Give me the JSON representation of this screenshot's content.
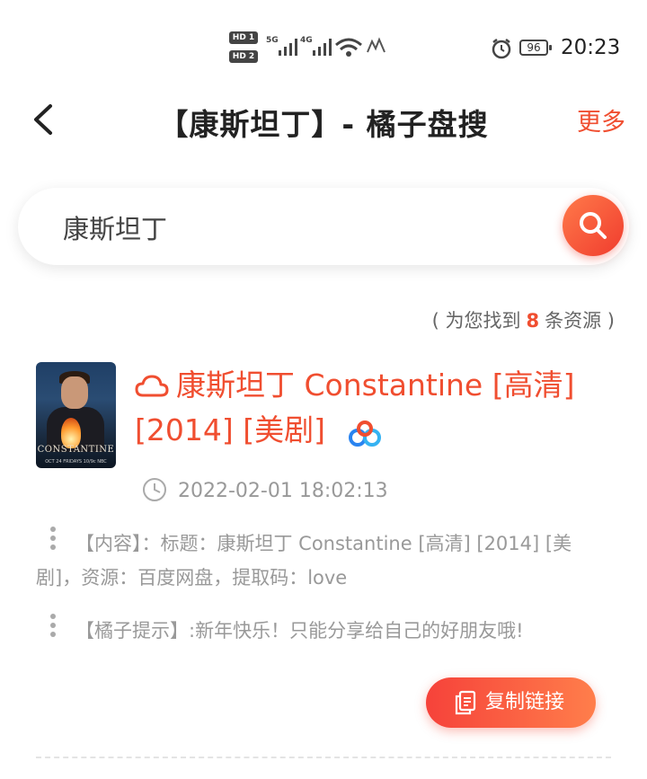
{
  "status_bar": {
    "hd1": "HD 1",
    "hd2": "HD 2",
    "net1": "5G",
    "net2": "4G",
    "battery": "96",
    "time": "20:23"
  },
  "header": {
    "title": "【康斯坦丁】- 橘子盘搜",
    "more_label": "更多"
  },
  "search": {
    "value": "康斯坦丁"
  },
  "results": {
    "count_prefix": "( 为您找到",
    "count": "8",
    "count_suffix": "条资源 )",
    "items": [
      {
        "poster_title": "CONSTANTINE",
        "poster_footer": "OCT 24 FRIDAYS 10/9c NBC",
        "title": "康斯坦丁 Constantine [高清] [2014] [美剧]",
        "time": "2022-02-01 18:02:13",
        "content": "【内容】：标题：康斯坦丁 Constantine [高清] [2014] [美剧]，资源：百度网盘，提取码：love",
        "tip": "【橘子提示】:新年快乐！只能分享给自己的好朋友哦!",
        "copy_label": "复制链接"
      }
    ]
  },
  "colors": {
    "accent": "#f04e30",
    "text_muted": "#999999"
  }
}
